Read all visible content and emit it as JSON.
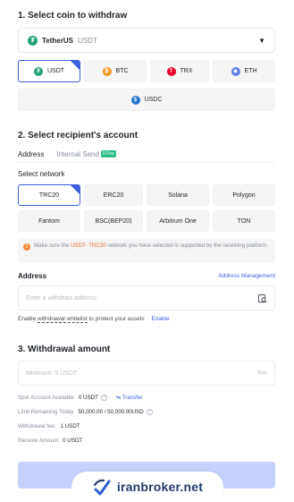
{
  "step1": {
    "title": "1. Select coin to withdraw",
    "coin_select": {
      "name": "TetherUS",
      "symbol": "USDT",
      "icon": "tether-icon",
      "caret": "▼"
    },
    "quick_coins": [
      {
        "label": "USDT",
        "icon": "tether-icon",
        "color": "#26a17b",
        "glyph": "₮",
        "selected": true
      },
      {
        "label": "BTC",
        "icon": "bitcoin-icon",
        "color": "#f7931a",
        "glyph": "₿",
        "selected": false
      },
      {
        "label": "TRX",
        "icon": "tron-icon",
        "color": "#eb0029",
        "glyph": "T",
        "selected": false
      },
      {
        "label": "ETH",
        "icon": "ethereum-icon",
        "color": "#627eea",
        "glyph": "◆",
        "selected": false
      },
      {
        "label": "USDC",
        "icon": "usdc-icon",
        "color": "#2775ca",
        "glyph": "$",
        "selected": false
      }
    ]
  },
  "step2": {
    "title": "2. Select recipient's account",
    "tabs": [
      {
        "label": "Address",
        "active": true
      },
      {
        "label": "Internal Send",
        "active": false,
        "badge": "0 Fee"
      }
    ],
    "network_label": "Select network",
    "networks": [
      {
        "label": "TRC20",
        "selected": true
      },
      {
        "label": "ERC20",
        "selected": false
      },
      {
        "label": "Solana",
        "selected": false
      },
      {
        "label": "Polygon",
        "selected": false
      },
      {
        "label": "Fantom",
        "selected": false
      },
      {
        "label": "BSC(BEP20)",
        "selected": false
      },
      {
        "label": "Arbitrum One",
        "selected": false
      },
      {
        "label": "TON",
        "selected": false
      }
    ],
    "notice": {
      "icon": "warning-icon",
      "prefix": "Make sure the ",
      "highlight": "USDT- TRC20",
      "suffix": " network you have selected is supported by the receiving platform."
    },
    "address_label": "Address",
    "address_management": "Address Management",
    "address_placeholder": "Enter a withdraw address",
    "whitelist": {
      "prefix": "Enable ",
      "link": "withdrawal whitelist",
      "suffix": " to protect your assets",
      "enable": "Enable"
    }
  },
  "step3": {
    "title": "3. Withdrawal amount",
    "amount_placeholder": "Minimum: 5 USDT",
    "max_label": "Max",
    "rows": [
      {
        "label": "Spot Account Available",
        "value": "0 USDT",
        "has_help": true,
        "action": "⇆ Transfer"
      },
      {
        "label": "Limit Remaining Today",
        "value": "50,000.00 / 50,000.00USD",
        "has_help": true
      },
      {
        "label": "Withdrawal fee:",
        "value": "1 USDT",
        "has_help": false
      },
      {
        "label": "Receive Amount",
        "value": "0 USDT",
        "has_help": false
      }
    ]
  },
  "submit": {
    "color": "#c5d2fb"
  },
  "watermark": {
    "text": "iranbroker.net"
  }
}
